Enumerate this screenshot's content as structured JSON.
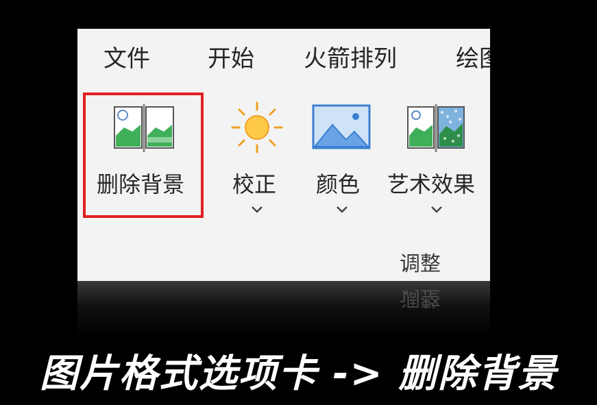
{
  "ribbon": {
    "tabs": [
      "文件",
      "开始",
      "火箭排列",
      "绘图"
    ],
    "buttons": {
      "remove_background": {
        "label": "删除背景",
        "icon": "remove-background-icon"
      },
      "corrections": {
        "label": "校正",
        "icon": "sun-icon"
      },
      "color": {
        "label": "颜色",
        "icon": "picture-color-icon"
      },
      "artistic_effects": {
        "label": "艺术效果",
        "icon": "artistic-effects-icon"
      }
    },
    "group_label": "调整"
  },
  "highlight_color": "#e02020",
  "caption": "图片格式选项卡 -> 删除背景"
}
